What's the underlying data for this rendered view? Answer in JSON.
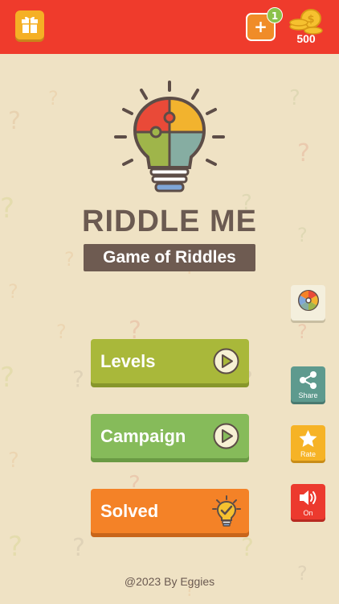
{
  "header": {
    "coins": "500",
    "badge_count": "1",
    "add_symbol": "+",
    "gift_icon": "gift-icon",
    "coins_icon": "coins-icon"
  },
  "logo": {
    "title": "RIDDLE ME",
    "subtitle": "Game of Riddles",
    "icon": "lightbulb-puzzle-icon"
  },
  "menu": {
    "levels_label": "Levels",
    "campaign_label": "Campaign",
    "solved_label": "Solved"
  },
  "side": {
    "wheel_icon": "lucky-wheel-icon",
    "share_label": "Share",
    "rate_label": "Rate",
    "sound_label": "On"
  },
  "footer": {
    "text": "@2023 By Eggies"
  },
  "colors": {
    "background": "#efe2c4",
    "topbar": "#ef3b2c",
    "levels": "#a9b83a",
    "campaign": "#86bb5a",
    "solved": "#f48227",
    "title": "#6b5a51"
  }
}
